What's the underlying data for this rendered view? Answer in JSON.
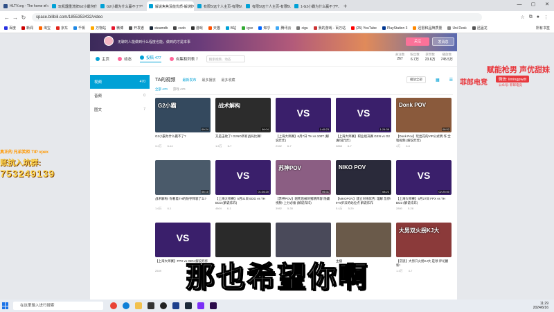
{
  "browser": {
    "tabs": [
      {
        "label": "HLTV.org - The home of co...",
        "color": "#2f4f86"
      },
      {
        "label": "玩机器重洗牌G2小霸为什么要...",
        "color": "#00a1d6"
      },
      {
        "label": "G2小霸为什么赢不了?",
        "color": "#00a1d6"
      },
      {
        "label": "解说焦焦没能优质-解说炸炸...",
        "color": "#00a1d6",
        "active": true
      },
      {
        "label": "有限5/远个人主页-有限5/...",
        "color": "#00a1d6"
      },
      {
        "label": "有限5/远个人主页-有限5/...",
        "color": "#00a1d6"
      },
      {
        "label": "1-G2小霸为什么赢不了?...",
        "color": "#00a1d6"
      }
    ],
    "url": "space.bilibili.com/1855353432/video",
    "bookmarks": [
      "百度",
      "新闻",
      "淘宝",
      "京东",
      "千帆",
      "万物站",
      "微博",
      "开发者",
      "steamdb",
      "csob",
      "游戏",
      "天猫",
      "B站",
      "igxe",
      "知乎",
      "腾讯云",
      "cigu",
      "我的游戏 - 百万站",
      "(25) YouTube",
      "PlayStation 3",
      "迅雷和品牌质量",
      "Uni Desk",
      "迅猛龙"
    ],
    "bookmarks_right": "所有书签"
  },
  "bili": {
    "sign": "无聊的人能做到什么程度也能，做到的才是本事",
    "follow": "关注",
    "message": "发消息",
    "nav": [
      {
        "label": "主页",
        "color": "#00a1d6"
      },
      {
        "label": "动态",
        "color": "#f69"
      },
      {
        "label": "投稿 477",
        "color": "#00a1d6",
        "active": true
      },
      {
        "label": "合集和列表 7",
        "color": "#f69"
      }
    ],
    "search_placeholder": "搜索视频、动态",
    "stats": [
      {
        "label": "关注数",
        "value": "267"
      },
      {
        "label": "粉丝数",
        "value": "6.7万"
      },
      {
        "label": "获赞数",
        "value": "23.6万"
      },
      {
        "label": "播放数",
        "value": "745.5万"
      }
    ],
    "side": [
      {
        "label": "视频",
        "count": "470",
        "active": true
      },
      {
        "label": "音频",
        "count": "0"
      },
      {
        "label": "图文",
        "count": "7"
      }
    ],
    "section_title": "TA的视频",
    "sort": [
      {
        "label": "最新发布",
        "active": true
      },
      {
        "label": "最多播放"
      },
      {
        "label": "最多收藏"
      }
    ],
    "play_all": "播放全部",
    "filters": [
      {
        "label": "全部 470",
        "active": true
      },
      {
        "label": "游戏 470"
      }
    ],
    "videos": [
      {
        "cap": "G2小霸为什么赢不了?",
        "views": "3.2万",
        "date": "6-14",
        "dur": "09:24",
        "bg": "#34495e",
        "text": "G2小霸"
      },
      {
        "cap": "又是击败了! G2NO所有战局比赛！",
        "views": "1.6万",
        "date": "6-7",
        "dur": "06:04",
        "bg": "#2c2c2c",
        "text": "战术解构"
      },
      {
        "cap": "【上海大师赛】6月7日 TH vs 100T (解说炸炸)",
        "views": "2342",
        "date": "6-7",
        "dur": "1:45:23",
        "bg": "#3a1f6b",
        "vs": "VS"
      },
      {
        "cap": "【上海大师赛】职业组决赛 GEN vs G2 (解说炸炸)",
        "views": "3868",
        "date": "6-7",
        "dur": "1:24:39",
        "bg": "#3a1f6b",
        "vs": "VS"
      },
      {
        "cap": "【Donk Pov】玩出花的VIP公式明 作 全程视频 (解说炸炸)",
        "views": "4万",
        "date": "6-6",
        "dur": "08:52",
        "bg": "#8a5a3c",
        "text": "Donk POV"
      },
      {
        "cap": "战术解构! 你看着TH的防守阵容了么?",
        "views": "1.6万",
        "date": "6-1",
        "dur": "06:10",
        "bg": "#4a5a6a"
      },
      {
        "cap": "【上海大师赛】5月31日 EDG vs TH BO3 (解说炸炸)",
        "views": "4804",
        "date": "6-1",
        "dur": "01:26:20",
        "bg": "#3a1f6b",
        "vs": "VS"
      },
      {
        "cap": "【苏神POV】刚死后被的猪精阵容 隐藏视频! 上分必备 (解说炸炸)",
        "views": "3982",
        "date": "5-30",
        "dur": "06:11",
        "bg": "#8b5e83",
        "text": "苏神POV"
      },
      {
        "cap": "【NIKOPOV】建立对线优势: 理解 急停! 9+5步法的站位点 解说炸炸",
        "views": "5.4万",
        "date": "5-29",
        "dur": "08:22",
        "bg": "#2a2a3a",
        "text": "NIKO POV"
      },
      {
        "cap": "【上海大师赛】5月27日 FPX vs TH BO3 (解说炸炸)",
        "views": "2880",
        "date": "5-28",
        "dur": "02:25:50",
        "bg": "#3a1f6b",
        "vs": "VS"
      },
      {
        "cap": "【上海大师赛】FPX vs GEN 解说炸炸",
        "views": "2549",
        "date": "",
        "dur": "",
        "bg": "#3a1f6b",
        "vs": "VS"
      },
      {
        "cap": "",
        "views": "",
        "date": "",
        "dur": "",
        "bg": "#2a2a2a"
      },
      {
        "cap": "",
        "views": "",
        "date": "",
        "dur": "",
        "bg": "#4a4a5a"
      },
      {
        "cap": "主播",
        "views": "",
        "date": "",
        "dur": "",
        "bg": "#6a5a4a"
      },
      {
        "cap": "【沉思】大男只火拐KJ大 是领 评论翻新!",
        "views": "1.4万",
        "date": "4-7",
        "dur": "",
        "bg": "#8b3a3a",
        "text": "大男双火拐KJ大"
      }
    ]
  },
  "overlay": {
    "left_top": "真正的 兄弟笑柜 TIP vpex",
    "qq_label": "账抗入坑群:",
    "qq_number": "753249139",
    "slogan": "赋能枪男 声优甜妹",
    "logo": "菲郎电竞",
    "wechat": "微信: limingpwdt",
    "gzh": "公众号: 菲郎电竞",
    "subtitle": "那也希望你啊"
  },
  "taskbar": {
    "search": "在这里输入进行搜索",
    "time": "11:29",
    "date": "2024/6/16"
  }
}
